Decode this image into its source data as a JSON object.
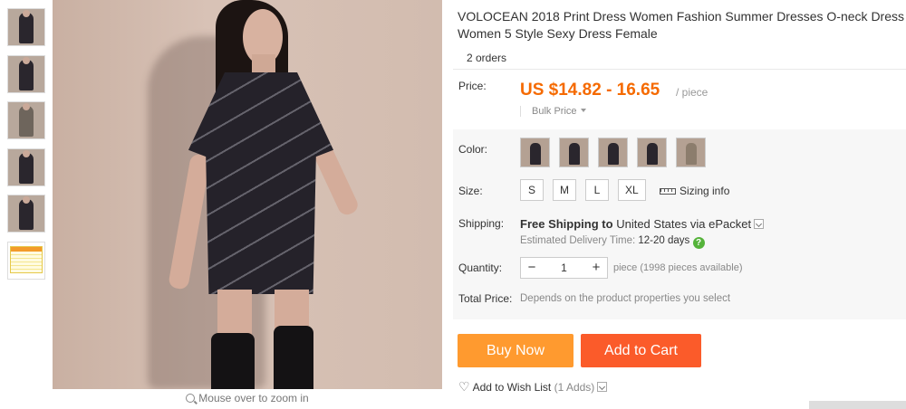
{
  "product": {
    "title": "VOLOCEAN 2018 Print Dress Women Fashion Summer Dresses O-neck Dress Women 5 Style Sexy Dress Female",
    "orders": "2 orders"
  },
  "gallery": {
    "thumbnail_count": 6,
    "zoom_hint": "Mouse over to zoom in"
  },
  "price": {
    "label": "Price:",
    "value": "US $14.82 - 16.65",
    "unit": "/ piece",
    "bulk_label": "Bulk Price",
    "color": "#f56a00"
  },
  "color": {
    "label": "Color:",
    "swatch_count": 5
  },
  "size": {
    "label": "Size:",
    "options": [
      "S",
      "M",
      "L",
      "XL"
    ],
    "sizing_info": "Sizing info"
  },
  "shipping": {
    "label": "Shipping:",
    "free": "Free Shipping",
    "to_text": "to",
    "destination": "United States via ePacket",
    "delivery_label": "Estimated Delivery Time:",
    "delivery_days": "12-20 days"
  },
  "quantity": {
    "label": "Quantity:",
    "value": "1",
    "minus": "−",
    "plus": "+",
    "note": "piece (1998 pieces available)"
  },
  "total": {
    "label": "Total Price:",
    "note": "Depends on the product properties you select"
  },
  "actions": {
    "buy_now": "Buy Now",
    "add_to_cart": "Add to Cart",
    "buy_color": "#ff9a2f",
    "cart_color": "#fb5b2a"
  },
  "wishlist": {
    "label": "Add to Wish List",
    "count": "(1 Adds)"
  }
}
